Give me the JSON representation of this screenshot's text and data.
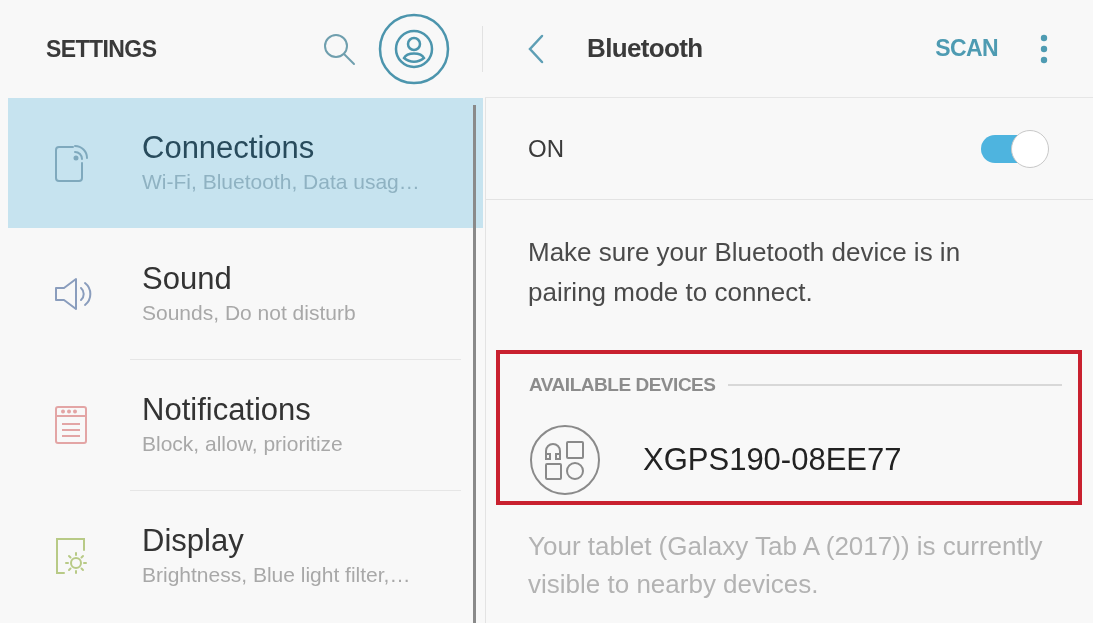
{
  "settings": {
    "title": "SETTINGS",
    "items": [
      {
        "kind": "connections",
        "title": "Connections",
        "subtitle": "Wi-Fi, Bluetooth, Data usag…",
        "selected": true
      },
      {
        "kind": "sound",
        "title": "Sound",
        "subtitle": "Sounds, Do not disturb",
        "selected": false
      },
      {
        "kind": "notifications",
        "title": "Notifications",
        "subtitle": "Block, allow, prioritize",
        "selected": false
      },
      {
        "kind": "display",
        "title": "Display",
        "subtitle": "Brightness, Blue light filter,…",
        "selected": false
      }
    ]
  },
  "bluetooth": {
    "title": "Bluetooth",
    "action": "SCAN",
    "switch": {
      "label": "ON",
      "on": true
    },
    "hint": "Make sure your Bluetooth device is in pairing mode to connect.",
    "available_devices": {
      "heading": "AVAILABLE DEVICES",
      "highlighted": true,
      "devices": [
        {
          "name": "XGPS190-08EE77"
        }
      ]
    },
    "note": "Your tablet (Galaxy Tab A (2017)) is currently visible to nearby devices."
  }
}
